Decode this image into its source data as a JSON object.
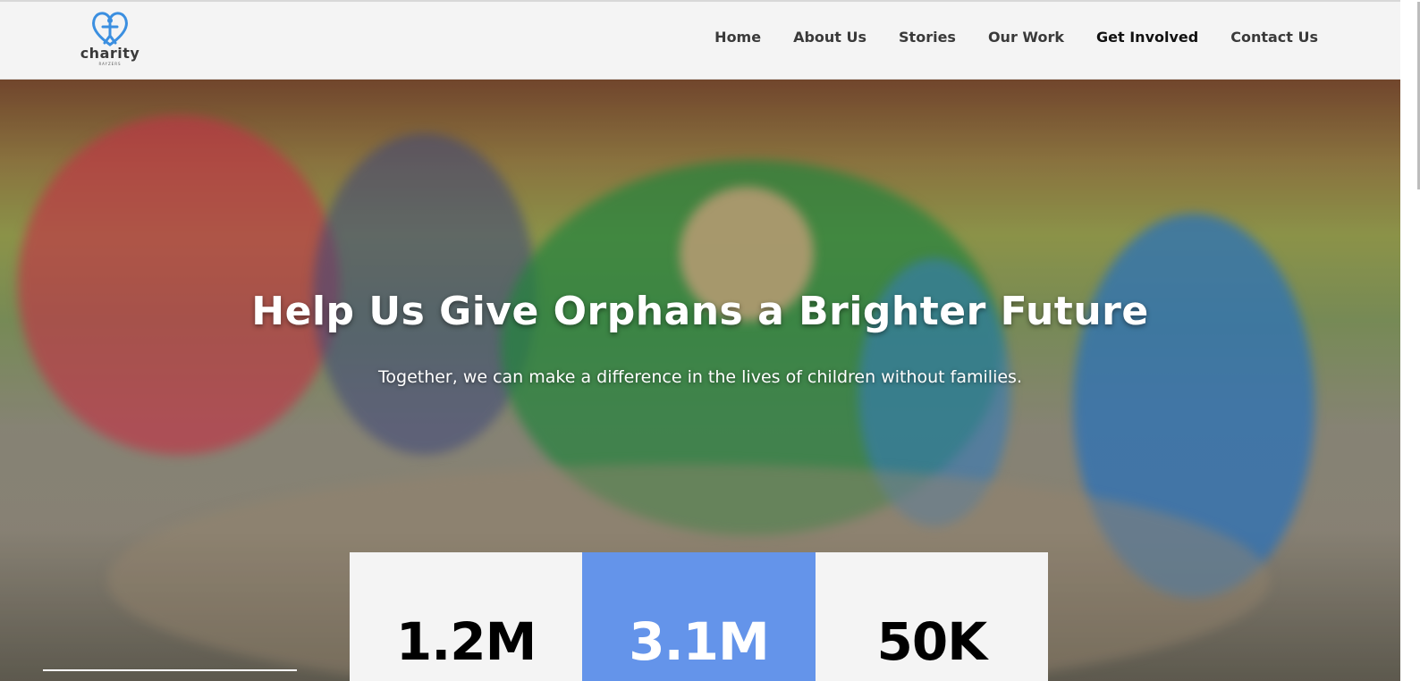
{
  "brand": {
    "name": "charity",
    "tagline": "RAYZERS",
    "logo_icon": "heart-person-icon",
    "accent_color": "#3b8fe0"
  },
  "nav": {
    "items": [
      {
        "label": "Home"
      },
      {
        "label": "About Us"
      },
      {
        "label": "Stories"
      },
      {
        "label": "Our Work"
      },
      {
        "label": "Get Involved"
      },
      {
        "label": "Contact Us"
      }
    ]
  },
  "hero": {
    "title": "Help Us Give Orphans a Brighter Future",
    "subtitle": "Together, we can make a difference in the lives of children without families."
  },
  "stats": [
    {
      "value": "1.2M"
    },
    {
      "value": "3.1M"
    },
    {
      "value": "50K"
    }
  ],
  "colors": {
    "header_bg": "#f4f4f4",
    "stat_highlight": "#6494ea",
    "nav_text": "#3a3a3a"
  }
}
